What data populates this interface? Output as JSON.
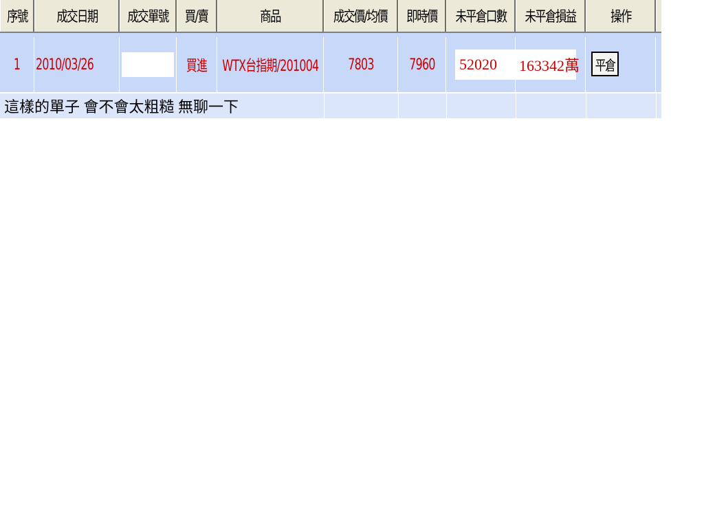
{
  "table": {
    "headers": [
      "序號",
      "成交日期",
      "成交單號",
      "買/賣",
      "商品",
      "成交價/均價",
      "即時價",
      "未平倉口數",
      "未平倉損益",
      "操作"
    ],
    "row": {
      "seq": "1",
      "date": "2010/03/26",
      "order_no": "",
      "side": "買進",
      "product": "WTX台指期/201004",
      "price": "7803",
      "realtime": "7960",
      "open_lots": "52020",
      "unrealized_pl": "163342萬",
      "action_label": "平倉"
    },
    "comment": "這樣的單子 會不會太粗糙  無聊一下"
  },
  "colors": {
    "header_bg": "#ece9d8",
    "row_bg": "#c8d8f8",
    "comment_bg": "#dce6fa",
    "value_text": "#cc0000"
  }
}
